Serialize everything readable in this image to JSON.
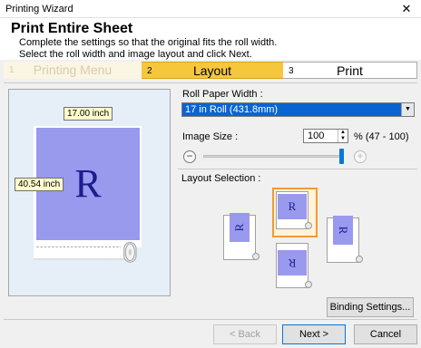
{
  "window": {
    "title": "Printing Wizard",
    "close_glyph": "✕"
  },
  "header": {
    "title": "Print Entire Sheet",
    "line1": "Complete the settings so that the original fits the roll width.",
    "line2": "Select the roll width and image layout and click Next."
  },
  "steps": [
    {
      "num": "1",
      "label": "Printing Menu",
      "state": "done"
    },
    {
      "num": "2",
      "label": "Layout",
      "state": "active"
    },
    {
      "num": "3",
      "label": "Print",
      "state": "pending"
    }
  ],
  "preview": {
    "width_label": "17.00 inch",
    "height_label": "40.54 inch",
    "image_letter": "R"
  },
  "roll_paper": {
    "label": "Roll Paper Width :",
    "value": "17 in Roll (431.8mm)"
  },
  "image_size": {
    "label": "Image Size :",
    "value": "100",
    "range": "% (47 - 100)",
    "slider_fraction": 1.0
  },
  "layout_selection": {
    "label": "Layout Selection :",
    "selected": "portrait",
    "letter": "R"
  },
  "buttons": {
    "binding": "Binding Settings...",
    "back": "< Back",
    "next": "Next >",
    "cancel": "Cancel"
  },
  "colors": {
    "accent": "#f6c73d",
    "selection": "#0a64d1",
    "image": "#9999ee",
    "focus": "#f29a39"
  }
}
